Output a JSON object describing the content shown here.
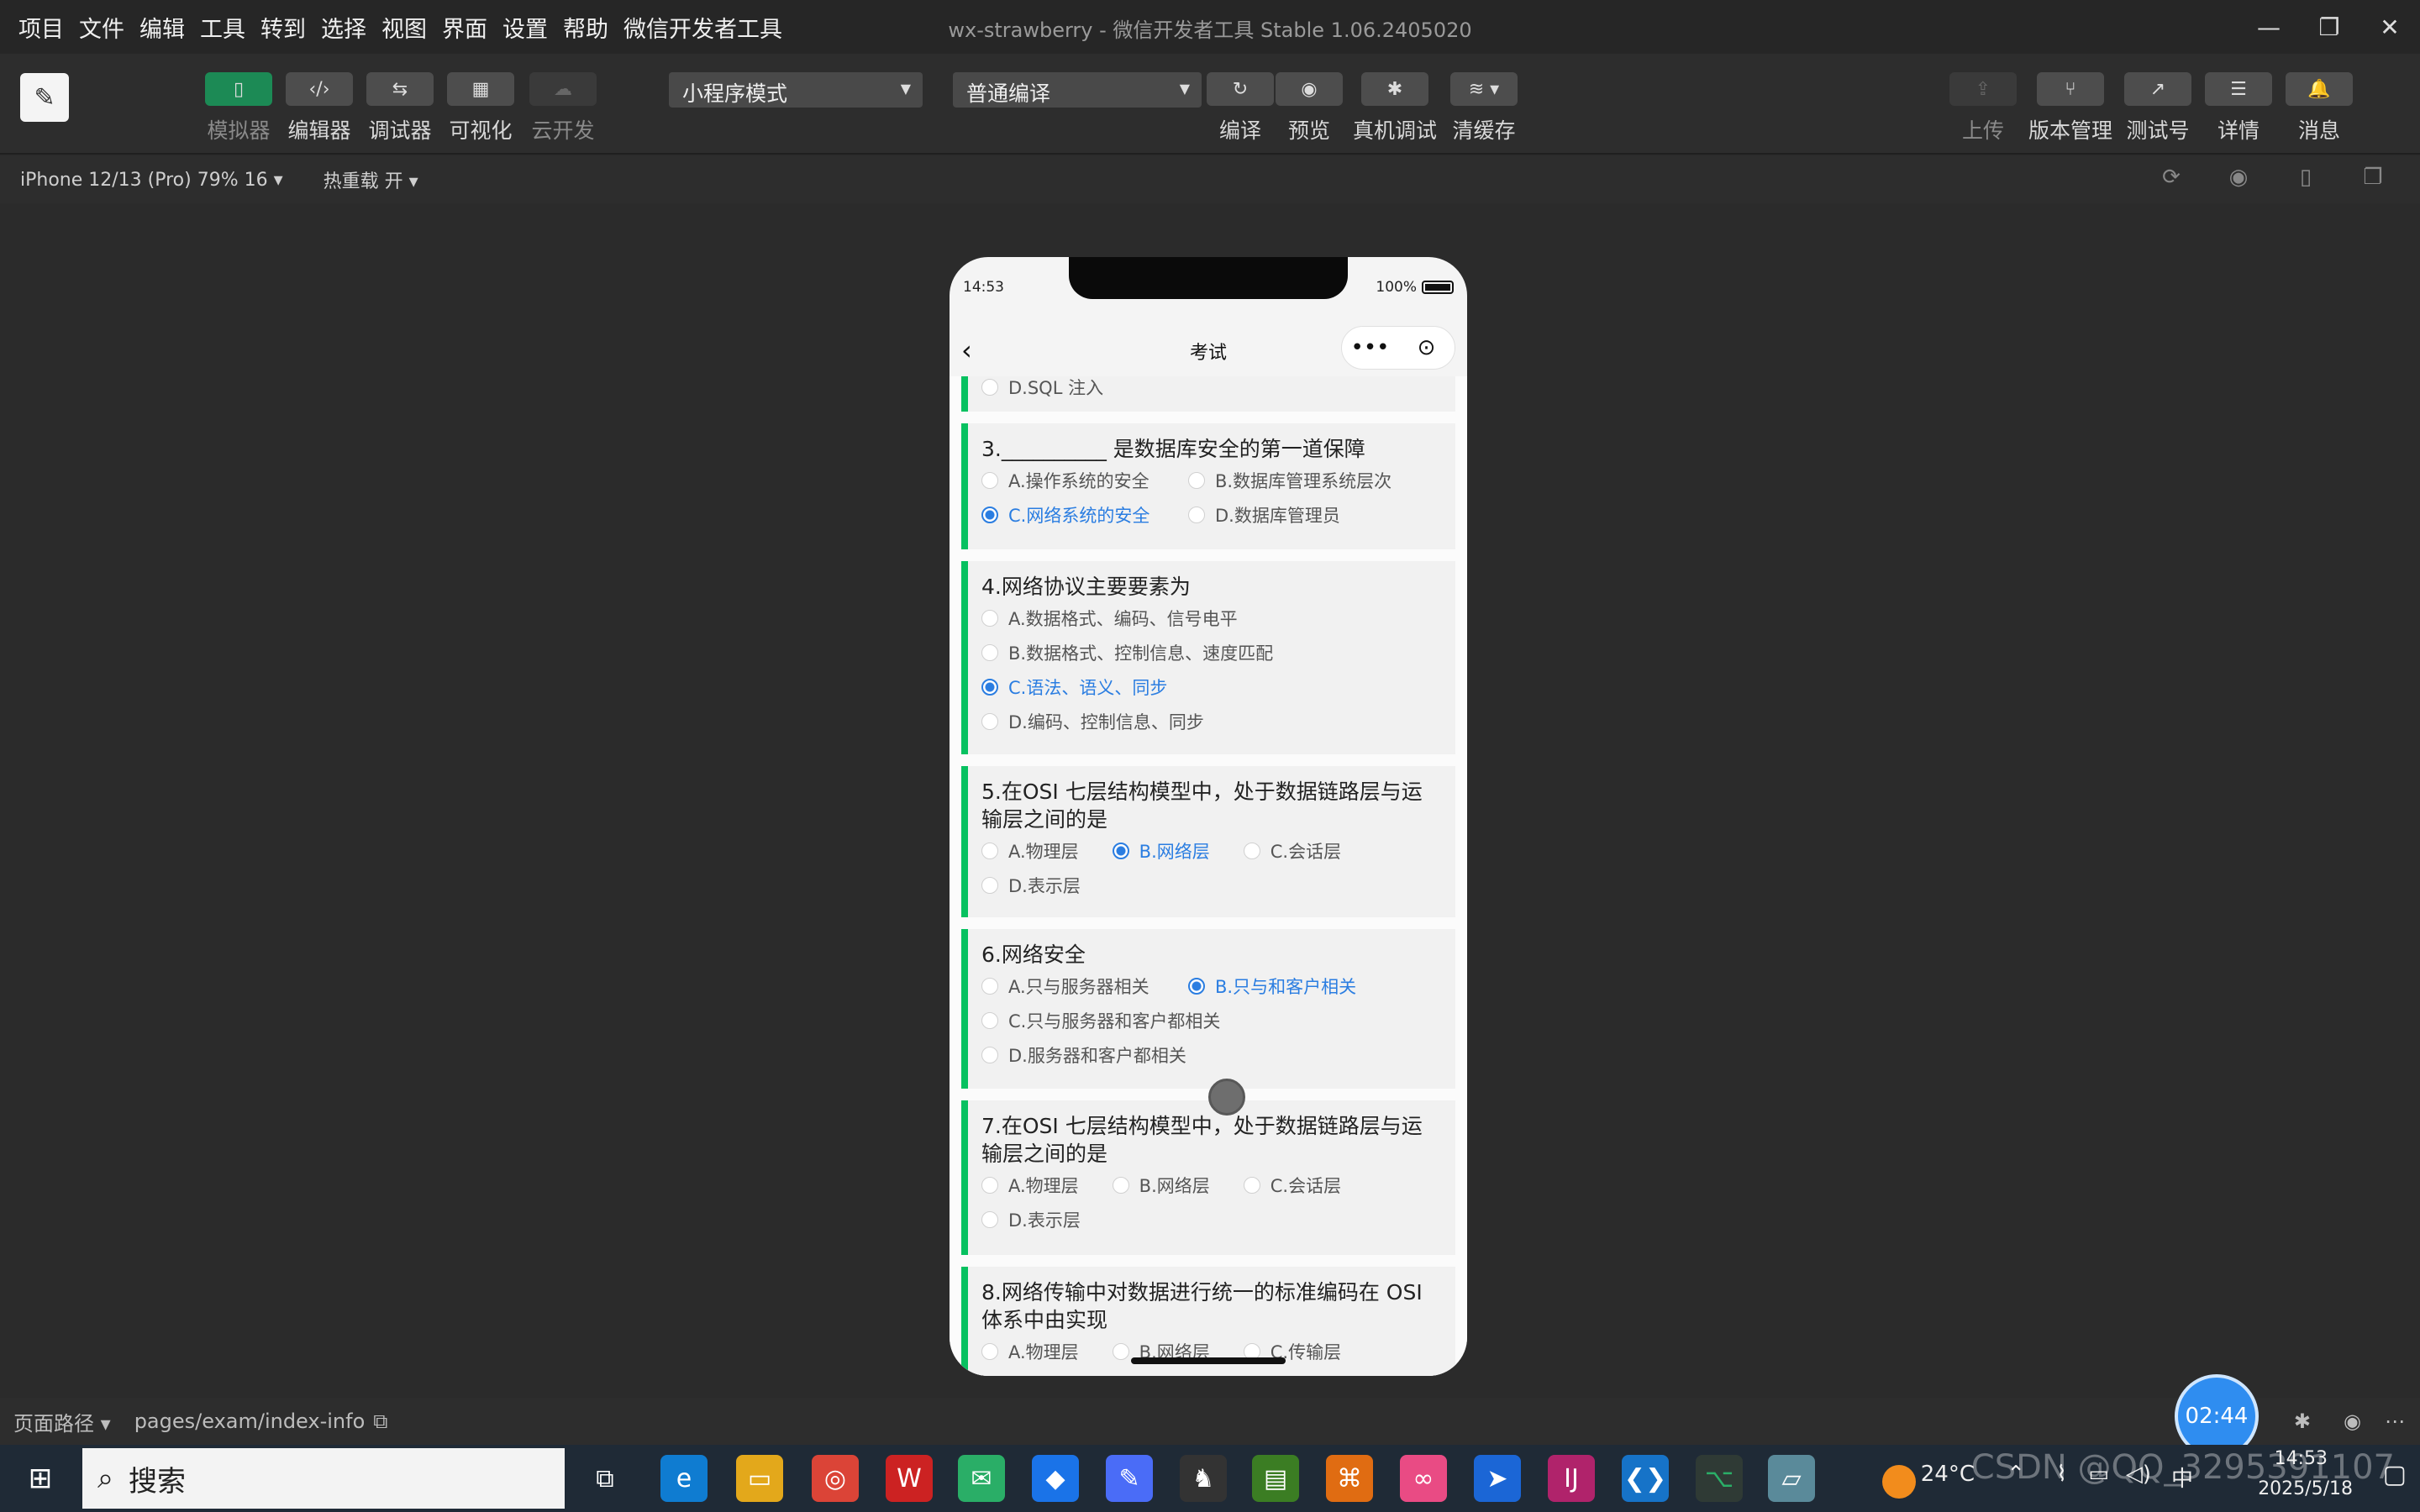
{
  "menubar": {
    "items": [
      "项目",
      "文件",
      "编辑",
      "工具",
      "转到",
      "选择",
      "视图",
      "界面",
      "设置",
      "帮助",
      "微信开发者工具"
    ],
    "title": "wx-strawberry - 微信开发者工具 Stable 1.06.2405020"
  },
  "toolbar": {
    "simulator": "模拟器",
    "editor": "编辑器",
    "debugger": "调试器",
    "visual": "可视化",
    "cloud": "云开发",
    "mode": "小程序模式",
    "compile_mode": "普通编译",
    "compile": "编译",
    "preview": "预览",
    "real_debug": "真机调试",
    "clear_cache": "清缓存",
    "upload": "上传",
    "version": "版本管理",
    "test": "测试号",
    "details": "详情",
    "messages": "消息"
  },
  "subbar": {
    "device": "iPhone 12/13 (Pro) 79% 16 ▾",
    "hotreload": "热重载 开 ▾"
  },
  "phone": {
    "time": "14:53",
    "battery": "100%",
    "title": "考试",
    "cards": [
      {
        "question": "",
        "options": [
          {
            "label": "D.SQL 注入",
            "selected": false
          }
        ]
      },
      {
        "question": "3.__________ 是数据库安全的第一道保障",
        "options": [
          {
            "label": "A.操作系统的安全",
            "selected": false
          },
          {
            "label": "B.数据库管理系统层次",
            "selected": false
          },
          {
            "label": "C.网络系统的安全",
            "selected": true
          },
          {
            "label": "D.数据库管理员",
            "selected": false
          }
        ]
      },
      {
        "question": "4.网络协议主要要素为",
        "options": [
          {
            "label": "A.数据格式、编码、信号电平",
            "selected": false
          },
          {
            "label": "B.数据格式、控制信息、速度匹配",
            "selected": false
          },
          {
            "label": "C.语法、语义、同步",
            "selected": true
          },
          {
            "label": "D.编码、控制信息、同步",
            "selected": false
          }
        ]
      },
      {
        "question": "5.在OSI 七层结构模型中，处于数据链路层与运输层之间的是",
        "options": [
          {
            "label": "A.物理层",
            "selected": false
          },
          {
            "label": "B.网络层",
            "selected": true
          },
          {
            "label": "C.会话层",
            "selected": false
          },
          {
            "label": "D.表示层",
            "selected": false
          }
        ]
      },
      {
        "question": "6.网络安全",
        "options": [
          {
            "label": "A.只与服务器相关",
            "selected": false
          },
          {
            "label": "B.只与和客户相关",
            "selected": true
          },
          {
            "label": "C.只与服务器和客户都相关",
            "selected": false
          },
          {
            "label": "D.服务器和客户都相关",
            "selected": false
          }
        ]
      },
      {
        "question": "7.在OSI 七层结构模型中，处于数据链路层与运输层之间的是",
        "options": [
          {
            "label": "A.物理层",
            "selected": false
          },
          {
            "label": "B.网络层",
            "selected": false
          },
          {
            "label": "C.会话层",
            "selected": false
          },
          {
            "label": "D.表示层",
            "selected": false
          }
        ]
      },
      {
        "question": "8.网络传输中对数据进行统一的标准编码在 OSI 体系中由实现",
        "options": [
          {
            "label": "A.物理层",
            "selected": false
          },
          {
            "label": "B.网络层",
            "selected": false
          },
          {
            "label": "C.传输层",
            "selected": false
          }
        ]
      }
    ]
  },
  "statusbar": {
    "page_path_label": "页面路径 ▾",
    "page_path": "pages/exam/index-info",
    "timer": "02:44"
  },
  "taskbar": {
    "search": "搜索",
    "weather": "24°C",
    "time": "14:53",
    "date": "2025/5/18",
    "ime": "中",
    "watermark": "CSDN @QQ_3295391107"
  },
  "colors": {
    "accent_green": "#07c160",
    "selected_blue": "#2a7de1",
    "active_tab": "#1c8a55"
  }
}
